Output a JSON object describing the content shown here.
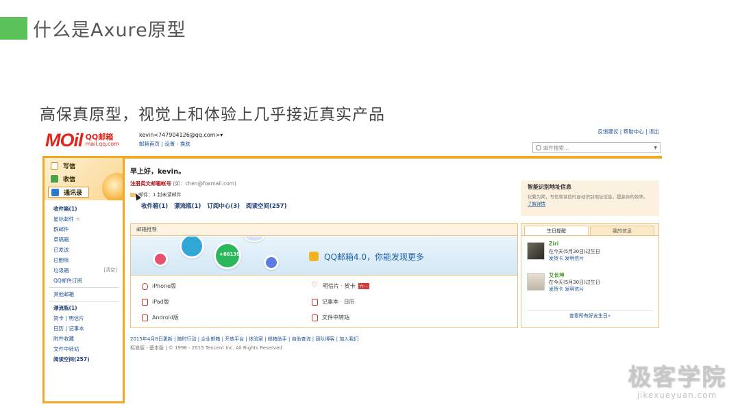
{
  "slide": {
    "title": "什么是Axure原型",
    "subtitle": "高保真原型，视觉上和体验上几乎接近真实产品"
  },
  "mail": {
    "logo": {
      "word": "MOil",
      "brand": "QQ邮箱",
      "url": "mail.qq.com"
    },
    "user": {
      "name": "kevin<747904126@qq.com>▾",
      "links": "邮箱首页 | 设置 - 换肤"
    },
    "top_links": "反馈建议 | 帮助中心 | 退出",
    "search_placeholder": "邮件搜索...",
    "sidebar": {
      "write": "写信",
      "inbox": "收信",
      "contacts": "通讯录",
      "folders": [
        {
          "label": "收件箱(1)",
          "bold": true
        },
        {
          "label": "星标邮件 ☆",
          "bold": false
        },
        {
          "label": "群邮件",
          "bold": false
        },
        {
          "label": "草稿箱",
          "bold": false
        },
        {
          "label": "已发送",
          "bold": false
        },
        {
          "label": "已删除",
          "bold": false
        },
        {
          "label": "垃圾箱",
          "bold": false,
          "extra": "[清空]"
        },
        {
          "label": "QQ邮件订阅",
          "bold": false
        }
      ],
      "other": "其他邮箱",
      "tools": [
        {
          "label": "漂流瓶(1)",
          "bold": true
        },
        {
          "label": "贺卡 | 明信片",
          "bold": false
        },
        {
          "label": "日历 | 记事本",
          "bold": false
        },
        {
          "label": "附件收藏",
          "bold": false
        },
        {
          "label": "文件中转站",
          "bold": false
        },
        {
          "label": "阅读空间(257)",
          "bold": true
        }
      ]
    },
    "main": {
      "greeting": "早上好，kevin。",
      "register_link": "注册英文邮箱帐号",
      "register_hint": "(如：chen@foxmail.com)",
      "unread": "邮件：1 封未读邮件",
      "quick_folders": [
        "收件箱(1)",
        "漂流瓶(1)",
        "订阅中心(3)",
        "阅读空间(257)"
      ]
    },
    "recommend": {
      "title": "邮箱推荐",
      "banner_badge": "+86139",
      "banner_text": "QQ邮箱4.0，你能发现更多",
      "links": {
        "iphone": "iPhone版",
        "ipad": "iPad版",
        "android": "Android版",
        "card": "明信片 · 贺卡",
        "card_badge": "六一",
        "note": "记事本 · 日历",
        "file": "文件中转站"
      }
    },
    "footer": {
      "links": "2015年4月8日更新 | 随时行动 | 企业邮箱 | 开放平台 | 体验室 | 邮箱助手 | 自助查询 | 团队博客 | 加入我们",
      "copyright": "标准版 - 基本版 | © 1998 - 2015 Tencent Inc. All Rights Reserved"
    },
    "smart": {
      "title": "智能识别地址信息",
      "body": "化繁为简，写信和读信时自动识别地址信息，提高你的效率。",
      "link": "了解详情"
    },
    "birthday": {
      "tabs": [
        "生日提醒",
        "我的信息"
      ],
      "people": [
        {
          "name": "Ziri",
          "date": "在今天(5月30日)过生日",
          "actions": "发贺卡  发明信片"
        },
        {
          "name": "艾长坤",
          "date": "在今天(5月30日)过生日",
          "actions": "发贺卡  发明信片"
        }
      ],
      "more": "查看所有好友生日»"
    }
  },
  "watermark": {
    "cn": "极客学院",
    "url": "jikexueyuan.com"
  },
  "colors": {
    "accent_green": "#5cc35a",
    "orange": "#f5a623",
    "link_blue": "#1e5494",
    "brand_red": "#e1251b"
  }
}
